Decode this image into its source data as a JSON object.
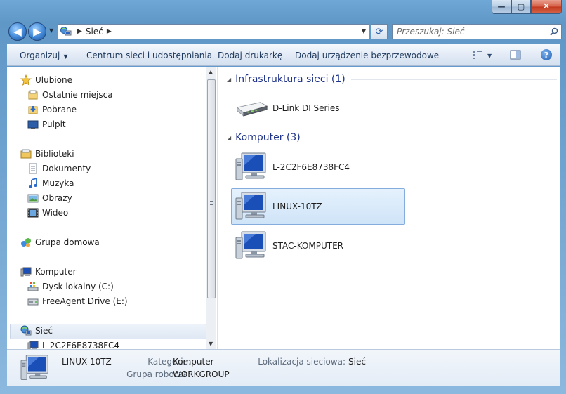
{
  "window": {
    "caption_buttons": [
      {
        "name": "minimize",
        "glyph": "—"
      },
      {
        "name": "maximize",
        "glyph": "▢"
      },
      {
        "name": "close",
        "glyph": "✕"
      }
    ]
  },
  "address_bar": {
    "path": "Sieć",
    "network_icon": "network-icon"
  },
  "search": {
    "placeholder": "Przeszukaj: Sieć"
  },
  "toolbar": {
    "organize": "Organizuj",
    "network_center": "Centrum sieci i udostępniania",
    "add_printer": "Dodaj drukarkę",
    "add_wireless": "Dodaj urządzenie bezprzewodowe"
  },
  "nav_pane": {
    "favorites": {
      "label": "Ulubione",
      "items": [
        "Ostatnie miejsca",
        "Pobrane",
        "Pulpit"
      ]
    },
    "libraries": {
      "label": "Biblioteki",
      "items": [
        "Dokumenty",
        "Muzyka",
        "Obrazy",
        "Wideo"
      ]
    },
    "homegroup": {
      "label": "Grupa domowa"
    },
    "computer": {
      "label": "Komputer",
      "items": [
        "Dysk lokalny (C:)",
        "FreeAgent Drive (E:)"
      ]
    },
    "network": {
      "label": "Sieć",
      "items": [
        "L-2C2F6E8738FC4"
      ]
    }
  },
  "content": {
    "groups": [
      {
        "title": "Infrastruktura sieci (1)",
        "items": [
          {
            "label": "D-Link DI Series",
            "icon": "router-icon"
          }
        ]
      },
      {
        "title": "Komputer (3)",
        "items": [
          {
            "label": "L-2C2F6E8738FC4",
            "icon": "computer-icon",
            "selected": false
          },
          {
            "label": "LINUX-10TZ",
            "icon": "computer-icon",
            "selected": true
          },
          {
            "label": "STAC-KOMPUTER",
            "icon": "computer-icon",
            "selected": false
          }
        ]
      }
    ]
  },
  "details": {
    "name": "LINUX-10TZ",
    "category_label": "Kategorie:",
    "category_value": "Komputer",
    "workgroup_label": "Grupa robocza:",
    "workgroup_value": "WORKGROUP",
    "location_label": "Lokalizacja sieciowa:",
    "location_value": "Sieć"
  },
  "colors": {
    "group_title": "#1e3287",
    "selection_border": "#84acdd",
    "command_text": "#1e395b"
  }
}
